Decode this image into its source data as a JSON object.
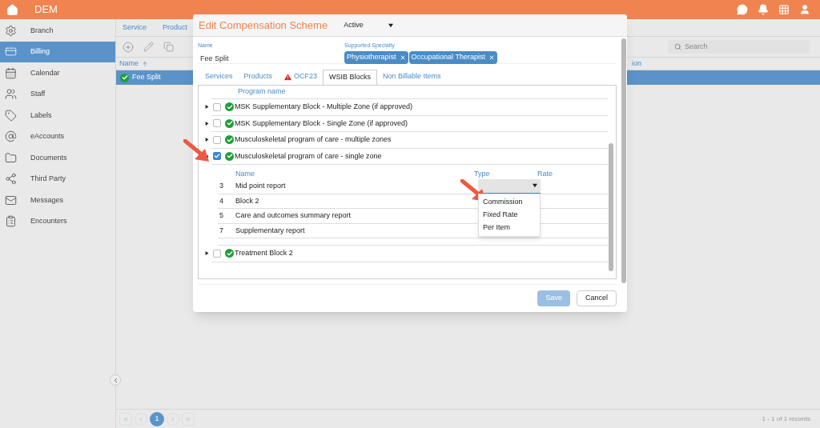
{
  "app": {
    "title": "DEM"
  },
  "sidebar": {
    "items": [
      {
        "label": "Branch",
        "selected": false
      },
      {
        "label": "Billing",
        "selected": true
      },
      {
        "label": "Calendar",
        "selected": false
      },
      {
        "label": "Staff",
        "selected": false
      },
      {
        "label": "Labels",
        "selected": false
      },
      {
        "label": "eAccounts",
        "selected": false
      },
      {
        "label": "Documents",
        "selected": false
      },
      {
        "label": "Third Party",
        "selected": false
      },
      {
        "label": "Messages",
        "selected": false
      },
      {
        "label": "Encounters",
        "selected": false
      }
    ]
  },
  "main": {
    "tabs": [
      "Service",
      "Product"
    ],
    "search": {
      "placeholder": "Search"
    },
    "table": {
      "columns": [
        {
          "label": "Name",
          "sorted": true
        },
        {
          "label": "ion"
        }
      ],
      "rows": [
        {
          "name": "Fee Split",
          "selected": true
        }
      ]
    },
    "pager": {
      "pages": [
        {
          "label": "1",
          "selected": true
        }
      ],
      "summary": "1 - 1 of 1 records"
    }
  },
  "dialog": {
    "title": "Edit Compensation Scheme",
    "status": "Active",
    "name_label": "Name",
    "name_value": "Fee Split",
    "specialty_label": "Supported Specialty",
    "specialties": [
      "Physiotherapist",
      "Occupational Therapist"
    ],
    "tabs": [
      {
        "label": "Services",
        "selected": false,
        "warning": false
      },
      {
        "label": "Products",
        "selected": false,
        "warning": false
      },
      {
        "label": "OCF23",
        "selected": false,
        "warning": true
      },
      {
        "label": "WSIB Blocks",
        "selected": true,
        "warning": false
      },
      {
        "label": "Non Billable Items",
        "selected": false,
        "warning": false
      }
    ],
    "table": {
      "column": "Program name",
      "sub_columns": [
        "Name",
        "Type",
        "Rate"
      ],
      "blocks": [
        {
          "name": "MSK Supplementary Block - Multiple Zone (if approved)",
          "checked": false,
          "expanded": false
        },
        {
          "name": "MSK Supplementary Block - Single Zone (if approved)",
          "checked": false,
          "expanded": false
        },
        {
          "name": "Musculoskeletal program of care - multiple zones",
          "checked": false,
          "expanded": false
        },
        {
          "name": "Musculoskeletal program of care - single zone",
          "checked": true,
          "expanded": true,
          "children": [
            {
              "number": "3",
              "name": "Mid point report",
              "dropdown_open": true
            },
            {
              "number": "4",
              "name": "Block 2",
              "dropdown_open": false
            },
            {
              "number": "5",
              "name": "Care and outcomes summary report",
              "dropdown_open": false
            },
            {
              "number": "7",
              "name": "Supplementary report",
              "dropdown_open": false
            }
          ]
        },
        {
          "name": "Treatment Block 2",
          "checked": false,
          "expanded": false
        }
      ]
    },
    "type_options": [
      "Commission",
      "Fixed Rate",
      "Per Item"
    ],
    "buttons": [
      {
        "label": "Save",
        "disabled": true
      },
      {
        "label": "Cancel",
        "disabled": false
      }
    ]
  }
}
